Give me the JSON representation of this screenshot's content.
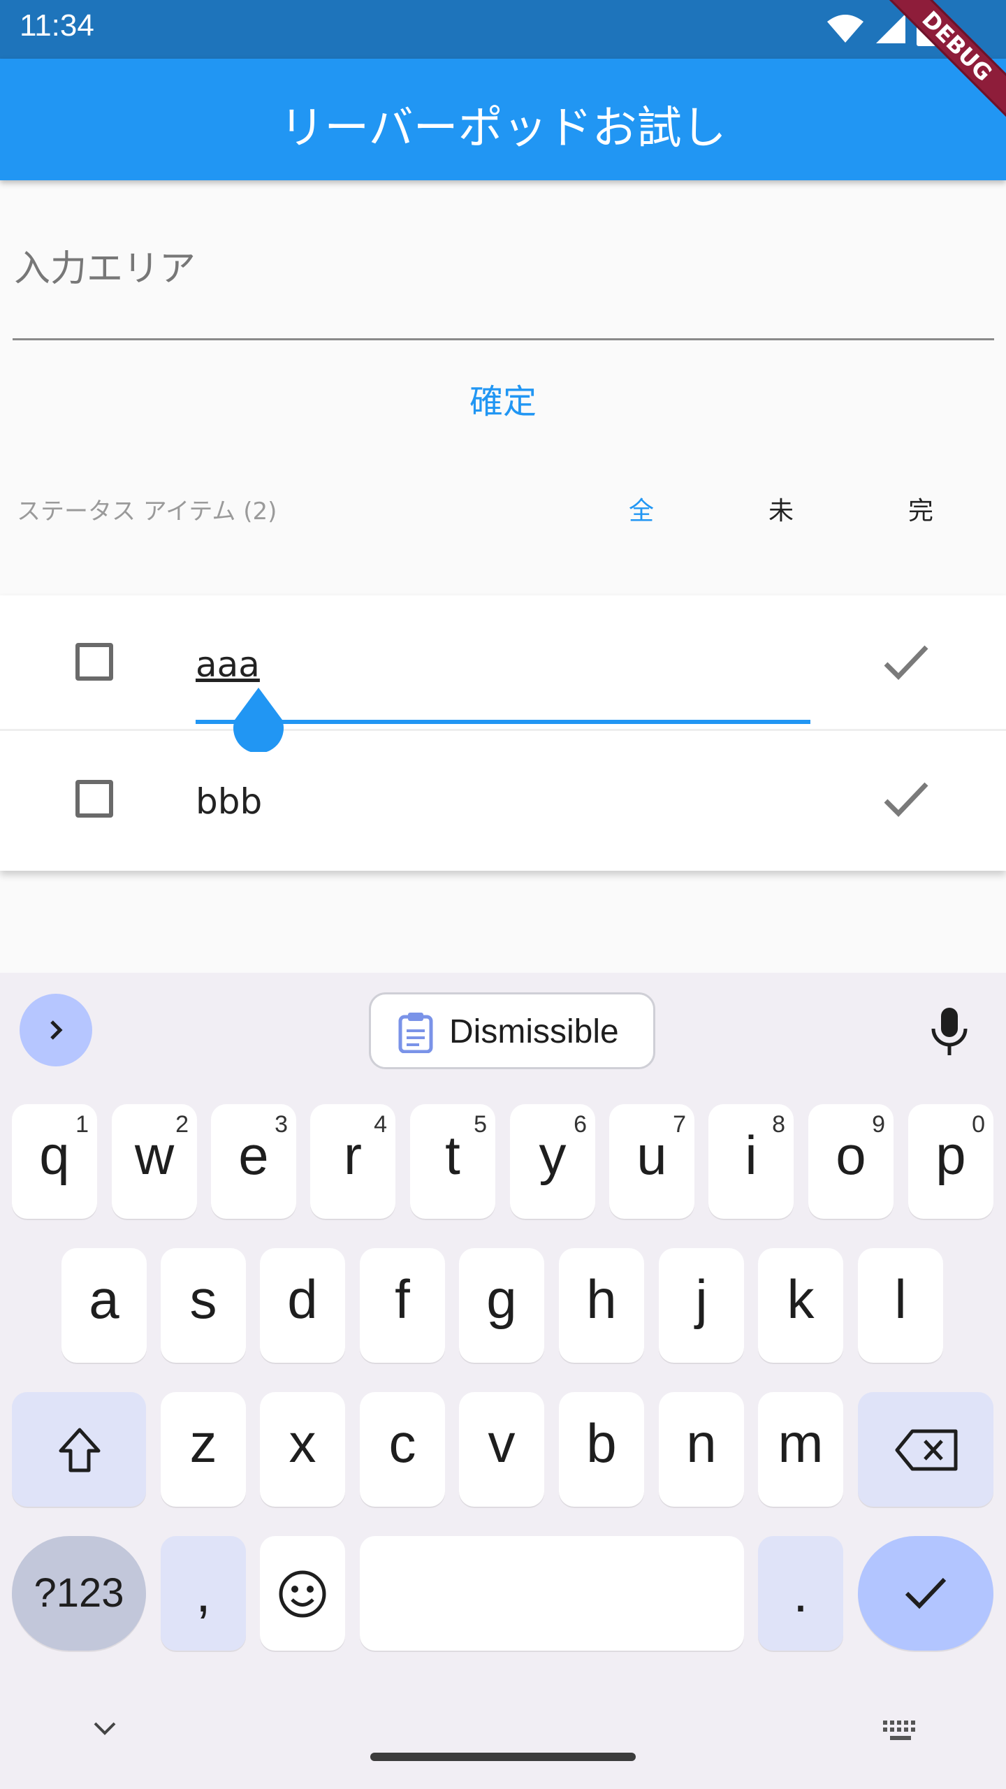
{
  "status_bar": {
    "time": "11:34"
  },
  "app_bar": {
    "title": "リーバーポッドお試し",
    "debug_label": "DEBUG"
  },
  "form": {
    "input_placeholder": "入力エリア",
    "confirm_label": "確定"
  },
  "status": {
    "label": "ステータス アイテム (2)",
    "filters": [
      {
        "label": "全",
        "selected": true
      },
      {
        "label": "未",
        "selected": false
      },
      {
        "label": "完",
        "selected": false
      }
    ]
  },
  "items": [
    {
      "text": "aaa",
      "checked": false,
      "editing": true
    },
    {
      "text": "bbb",
      "checked": false,
      "editing": false
    }
  ],
  "keyboard": {
    "suggestion_chip": "Dismissible",
    "row1": [
      {
        "ch": "q",
        "num": "1"
      },
      {
        "ch": "w",
        "num": "2"
      },
      {
        "ch": "e",
        "num": "3"
      },
      {
        "ch": "r",
        "num": "4"
      },
      {
        "ch": "t",
        "num": "5"
      },
      {
        "ch": "y",
        "num": "6"
      },
      {
        "ch": "u",
        "num": "7"
      },
      {
        "ch": "i",
        "num": "8"
      },
      {
        "ch": "o",
        "num": "9"
      },
      {
        "ch": "p",
        "num": "0"
      }
    ],
    "row2": [
      "a",
      "s",
      "d",
      "f",
      "g",
      "h",
      "j",
      "k",
      "l"
    ],
    "row3": [
      "z",
      "x",
      "c",
      "v",
      "b",
      "n",
      "m"
    ],
    "symbols_label": "?123",
    "comma_label": ",",
    "period_label": "."
  },
  "colors": {
    "primary": "#2196f3",
    "status_bar": "#1e74bb",
    "keyboard_bg": "#f1eef4",
    "accent_key": "#b2c5ff"
  }
}
